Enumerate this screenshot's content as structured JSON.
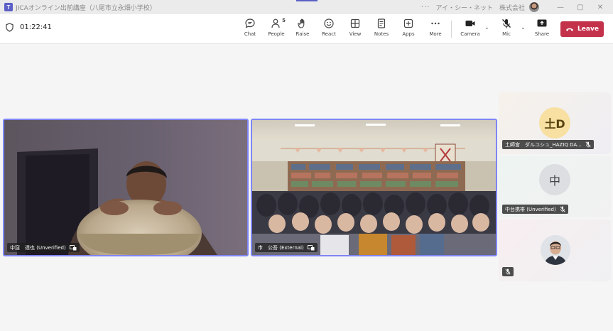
{
  "window": {
    "title": "JICAオンライン出前講座（八尾市立永畑小学校）",
    "org": "アイ・シー・ネット　株式会社",
    "more": "···",
    "minimize": "—",
    "maximize": "▢",
    "close": "✕"
  },
  "meeting": {
    "timer": "01:22:41"
  },
  "toolbar": {
    "chat": "Chat",
    "people": "People",
    "people_count": "5",
    "raise": "Raise",
    "react": "React",
    "view": "View",
    "notes": "Notes",
    "apps": "Apps",
    "more": "More",
    "camera": "Camera",
    "mic": "Mic",
    "share": "Share",
    "leave": "Leave"
  },
  "stage": [
    {
      "name": "中窪　達也 (Unverified)"
    },
    {
      "name": "市　公吾 (External)"
    }
  ],
  "roster": [
    {
      "initials": "土D",
      "name": "土師宮　ダルユシュ_HAZIQ DA..."
    },
    {
      "initials": "中",
      "name": "中台携帯 (Unverified)"
    },
    {
      "initials": "",
      "name": ""
    }
  ],
  "colors": {
    "accent": "#5b5fc7",
    "leave": "#c4314b",
    "tile_border": "#7f85f5"
  }
}
